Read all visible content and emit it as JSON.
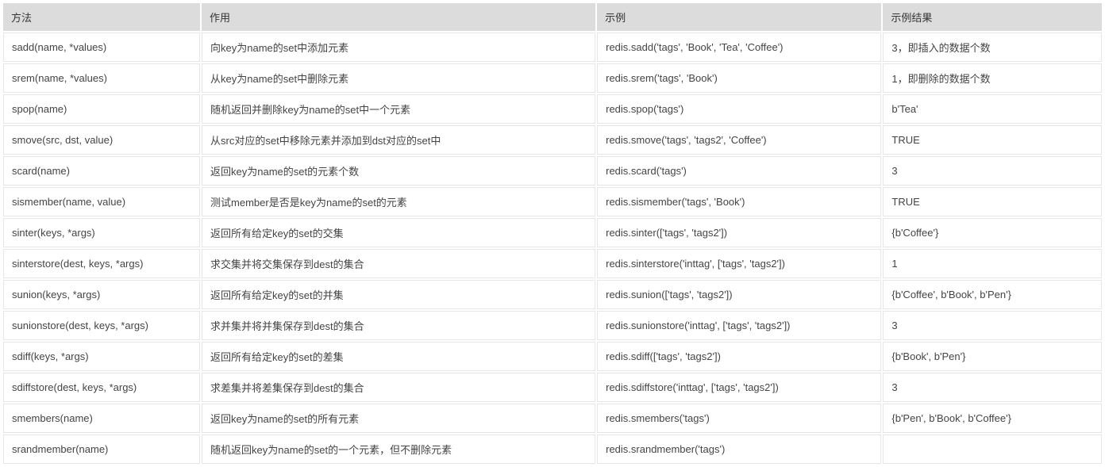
{
  "headers": [
    "方法",
    "作用",
    "示例",
    "示例结果"
  ],
  "rows": [
    {
      "method": "sadd(name, *values)",
      "desc": "向key为name的set中添加元素",
      "example": "redis.sadd('tags', 'Book', 'Tea', 'Coffee')",
      "result": "3，即插入的数据个数"
    },
    {
      "method": "srem(name, *values)",
      "desc": "从key为name的set中删除元素",
      "example": "redis.srem('tags', 'Book')",
      "result": "1，即删除的数据个数"
    },
    {
      "method": "spop(name)",
      "desc": "随机返回并删除key为name的set中一个元素",
      "example": "redis.spop('tags')",
      "result": "b'Tea'"
    },
    {
      "method": "smove(src, dst, value)",
      "desc": "从src对应的set中移除元素并添加到dst对应的set中",
      "example": "redis.smove('tags', 'tags2', 'Coffee')",
      "result": "TRUE"
    },
    {
      "method": "scard(name)",
      "desc": "返回key为name的set的元素个数",
      "example": "redis.scard('tags')",
      "result": "3"
    },
    {
      "method": "sismember(name, value)",
      "desc": "测试member是否是key为name的set的元素",
      "example": "redis.sismember('tags', 'Book')",
      "result": "TRUE"
    },
    {
      "method": "sinter(keys, *args)",
      "desc": "返回所有给定key的set的交集",
      "example": "redis.sinter(['tags', 'tags2'])",
      "result": "{b'Coffee'}"
    },
    {
      "method": "sinterstore(dest, keys, *args)",
      "desc": "求交集并将交集保存到dest的集合",
      "example": "redis.sinterstore('inttag', ['tags', 'tags2'])",
      "result": "1"
    },
    {
      "method": "sunion(keys, *args)",
      "desc": "返回所有给定key的set的并集",
      "example": "redis.sunion(['tags', 'tags2'])",
      "result": "{b'Coffee', b'Book', b'Pen'}"
    },
    {
      "method": "sunionstore(dest, keys, *args)",
      "desc": "求并集并将并集保存到dest的集合",
      "example": "redis.sunionstore('inttag', ['tags', 'tags2'])",
      "result": "3"
    },
    {
      "method": "sdiff(keys, *args)",
      "desc": "返回所有给定key的set的差集",
      "example": "redis.sdiff(['tags', 'tags2'])",
      "result": "{b'Book', b'Pen'}"
    },
    {
      "method": "sdiffstore(dest, keys, *args)",
      "desc": "求差集并将差集保存到dest的集合",
      "example": "redis.sdiffstore('inttag', ['tags', 'tags2'])",
      "result": "3"
    },
    {
      "method": "smembers(name)",
      "desc": "返回key为name的set的所有元素",
      "example": "redis.smembers('tags')",
      "result": "{b'Pen', b'Book', b'Coffee'}"
    },
    {
      "method": "srandmember(name)",
      "desc": "随机返回key为name的set的一个元素，但不删除元素",
      "example": "redis.srandmember('tags')",
      "result": ""
    }
  ]
}
